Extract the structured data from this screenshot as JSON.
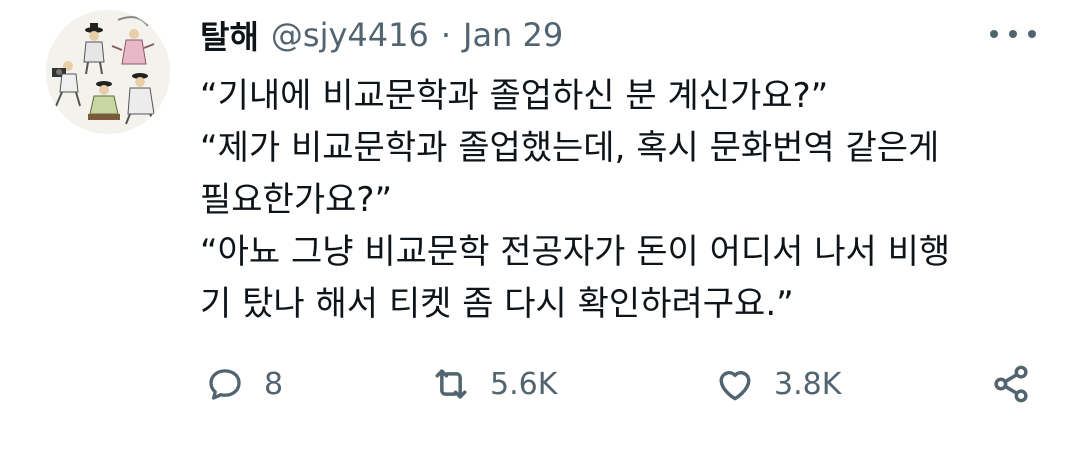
{
  "tweet": {
    "display_name": "탈해",
    "handle": "@sjy4416",
    "separator": "·",
    "date": "Jan 29",
    "lines": [
      "“기내에 비교문학과 졸업하신 분 계신가요?”",
      "“제가 비교문학과 졸업했는데, 혹시 문화번역 같은게",
      "필요한가요?”",
      "“아뇨 그냥 비교문학 전공자가 돈이 어디서 나서 비행",
      "기 탔나 해서 티켓 좀 다시 확인하려구요.”"
    ]
  },
  "actions": {
    "reply_count": "8",
    "retweet_count": "5.6K",
    "like_count": "3.8K"
  },
  "icons": {
    "reply": "reply-icon",
    "retweet": "retweet-icon",
    "like": "like-icon",
    "share": "share-icon",
    "more": "more-icon"
  },
  "colors": {
    "text_primary": "#0f1419",
    "text_secondary": "#536471",
    "background": "#ffffff"
  }
}
